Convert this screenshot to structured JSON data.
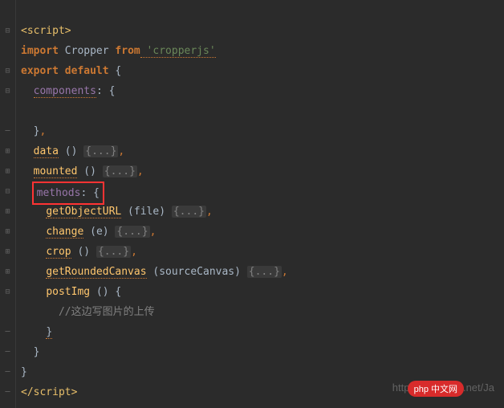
{
  "code": {
    "l1_tag_open": "<script>",
    "l2_import": "import",
    "l2_name": " Cropper ",
    "l2_from": "from",
    "l2_string": " 'cropperjs'",
    "l3_export": "export",
    "l3_default": " default",
    "l3_brace": " {",
    "l4_prop": "components",
    "l4_colon": ":",
    "l4_brace": " {",
    "l5_empty": "",
    "l6_brace": "}",
    "l6_comma": ",",
    "l7_prop": "data",
    "l7_paren": " () ",
    "l7_fold": "{...}",
    "l7_comma": ",",
    "l8_prop": "mounted",
    "l8_paren": " () ",
    "l8_fold": "{...}",
    "l8_comma": ",",
    "l9_prop": "methods",
    "l9_colon": ":",
    "l9_brace": " {",
    "l10_prop": "getObjectURL",
    "l10_paren_open": " (",
    "l10_param": "file",
    "l10_paren_close": ") ",
    "l10_fold": "{...}",
    "l10_comma": ",",
    "l11_prop": "change",
    "l11_paren_open": " (",
    "l11_param": "e",
    "l11_paren_close": ") ",
    "l11_fold": "{...}",
    "l11_comma": ",",
    "l12_prop": "crop",
    "l12_paren": " () ",
    "l12_fold": "{...}",
    "l12_comma": ",",
    "l13_prop": "getRoundedCanvas",
    "l13_paren_open": " (",
    "l13_param": "sourceCanvas",
    "l13_paren_close": ") ",
    "l13_fold": "{...}",
    "l13_comma": ",",
    "l14_prop": "postImg",
    "l14_paren": " () {",
    "l15_comment": "//这边写图片的上传",
    "l16_brace": "}",
    "l17_brace": "}",
    "l18_brace": "}",
    "l19_tag_close": "</script>"
  },
  "gutter": {
    "collapse": "⊟",
    "expand": "⊞",
    "line": "─"
  },
  "watermark": "http://blog.csdn.net/Ja",
  "badge": "php 中文网"
}
